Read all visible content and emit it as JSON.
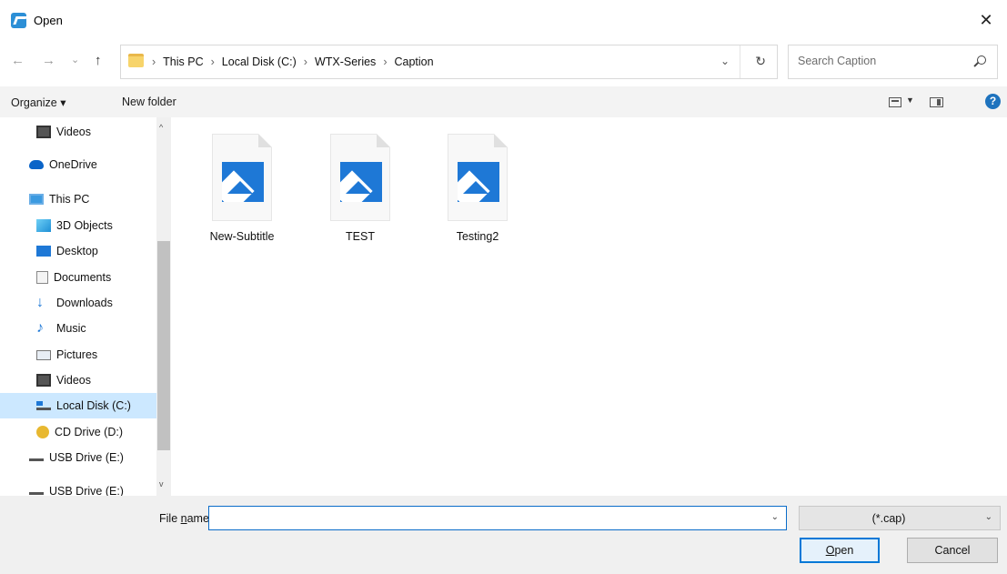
{
  "window": {
    "title": "Open",
    "close_glyph": "✕"
  },
  "nav": {
    "back_glyph": "←",
    "forward_glyph": "→",
    "recent_glyph": "⌄",
    "up_glyph": "↑",
    "breadcrumbs": [
      "This PC",
      "Local Disk (C:)",
      "WTX-Series",
      "Caption"
    ],
    "separator": "›",
    "dropdown_glyph": "⌄",
    "refresh_glyph": "↻"
  },
  "search": {
    "placeholder": "Search Caption"
  },
  "toolbar": {
    "organize_label": "Organize ▾",
    "new_folder_label": "New folder",
    "help_glyph": "?"
  },
  "sidebar": {
    "items": [
      {
        "label": "Videos",
        "icon": "video-icon"
      },
      {
        "label": "OneDrive",
        "icon": "cloud-icon"
      },
      {
        "label": "This PC",
        "icon": "computer-icon"
      },
      {
        "label": "3D Objects",
        "icon": "cube-icon"
      },
      {
        "label": "Desktop",
        "icon": "desktop-icon"
      },
      {
        "label": "Documents",
        "icon": "document-icon"
      },
      {
        "label": "Downloads",
        "icon": "download-icon"
      },
      {
        "label": "Music",
        "icon": "music-icon"
      },
      {
        "label": "Pictures",
        "icon": "picture-icon"
      },
      {
        "label": "Videos",
        "icon": "video-icon"
      },
      {
        "label": "Local Disk (C:)",
        "icon": "disk-icon",
        "selected": true
      },
      {
        "label": "CD Drive (D:)",
        "icon": "cd-icon"
      },
      {
        "label": "USB Drive (E:)",
        "icon": "usb-icon"
      },
      {
        "label": "USB Drive (E:)",
        "icon": "usb-icon"
      }
    ],
    "scroll_up_glyph": "^",
    "scroll_down_glyph": "v"
  },
  "files": [
    {
      "name": "New-Subtitle",
      "icon": "image-file-icon"
    },
    {
      "name": "TEST",
      "icon": "image-file-icon"
    },
    {
      "name": "Testing2",
      "icon": "image-file-icon"
    }
  ],
  "footer": {
    "file_name_label_pre": "File ",
    "file_name_label_u": "n",
    "file_name_label_post": "ame:",
    "file_name_value": "",
    "file_type": "(*.cap)",
    "open_u": "O",
    "open_rest": "pen",
    "cancel_label": "Cancel",
    "caret_glyph": "⌄"
  },
  "colors": {
    "accent": "#0078d7",
    "selected_bg": "#cce8ff",
    "folder": "#f7d46b"
  }
}
